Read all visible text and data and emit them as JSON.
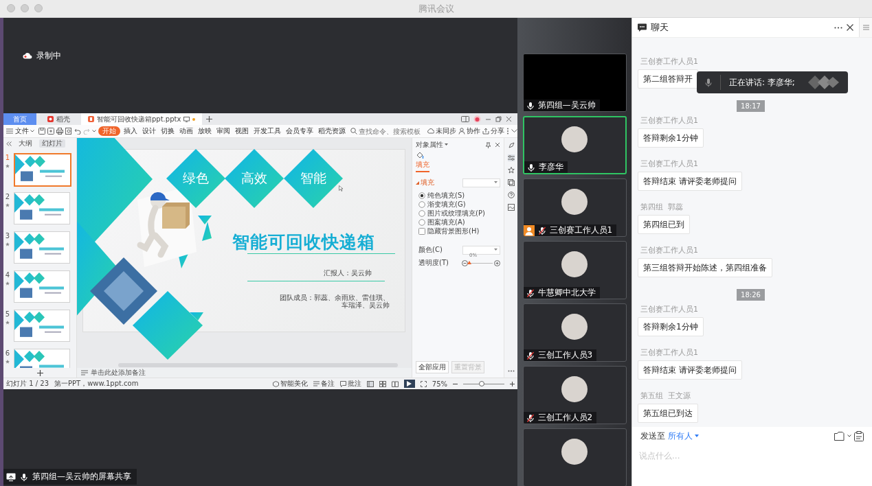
{
  "window": {
    "title": "腾讯会议"
  },
  "recording": {
    "label": "录制中"
  },
  "shared_window": {
    "tabs": [
      {
        "kind": "home",
        "label": "首页",
        "selected": false
      },
      {
        "kind": "store",
        "label": "稻壳",
        "selected": false
      },
      {
        "kind": "document",
        "label": "智能可回收快递箱ppt.pptx",
        "selected": true,
        "unsaved": true
      }
    ],
    "file_menu": "文件",
    "ribbon_tabs": [
      {
        "label": "开始",
        "selected": true
      },
      {
        "label": "插入",
        "selected": false
      },
      {
        "label": "设计",
        "selected": false
      },
      {
        "label": "切换",
        "selected": false
      },
      {
        "label": "动画",
        "selected": false
      },
      {
        "label": "放映",
        "selected": false
      },
      {
        "label": "审阅",
        "selected": false
      },
      {
        "label": "视图",
        "selected": false
      },
      {
        "label": "开发工具",
        "selected": false
      },
      {
        "label": "会员专享",
        "selected": false
      },
      {
        "label": "稻壳资源",
        "selected": false
      }
    ],
    "search": {
      "placeholder": "查找命令、搜索模板"
    },
    "actions": [
      {
        "kind": "sync",
        "label": "未同步"
      },
      {
        "kind": "collab",
        "label": "协作"
      },
      {
        "kind": "share",
        "label": "分享"
      }
    ],
    "pane_tabs": [
      {
        "label": "大纲",
        "selected": false
      },
      {
        "label": "幻灯片",
        "selected": true
      }
    ],
    "thumbnails": [
      {
        "number": "1",
        "selected": true
      },
      {
        "number": "2",
        "selected": false
      },
      {
        "number": "3",
        "selected": false
      },
      {
        "number": "4",
        "selected": false
      },
      {
        "number": "5",
        "selected": false
      },
      {
        "number": "6",
        "selected": false
      }
    ],
    "slide": {
      "tags": [
        "绿色",
        "高效",
        "智能"
      ],
      "title": "智能可回收快递箱",
      "reporter": "汇报人：吴云帅",
      "team": [
        "团队成员：郭蕊、余雨欣、雷佳琪、",
        "车瑞泽、吴云帅"
      ]
    },
    "notes": {
      "placeholder": "单击此处添加备注"
    },
    "properties": {
      "title": "对象属性",
      "tab": "填充",
      "section": "填充",
      "options": [
        {
          "kind": "radio",
          "label": "纯色填充(S)",
          "checked": true
        },
        {
          "kind": "radio",
          "label": "渐变填充(G)",
          "checked": false
        },
        {
          "kind": "radio",
          "label": "图片或纹理填充(P)",
          "checked": false
        },
        {
          "kind": "radio",
          "label": "图案填充(A)",
          "checked": false
        },
        {
          "kind": "checkbox",
          "label": "隐藏背景图形(H)",
          "checked": false
        }
      ],
      "color_label": "颜色(C)",
      "transparency_label": "透明度(T)",
      "transparency_reading": "0%",
      "transparency": {
        "level": 0
      },
      "buttons": [
        {
          "label": "全部应用",
          "disabled": false
        },
        {
          "label": "重置背景",
          "disabled": true
        }
      ]
    },
    "status_bar": {
      "slide_count": "幻灯片 1 / 23",
      "theme": "第一PPT，www.1ppt.com",
      "beautify": "智能美化",
      "notes": "备注",
      "comments": "批注",
      "views": [
        {
          "kind": "normal",
          "selected": true
        },
        {
          "kind": "sorter",
          "selected": false
        },
        {
          "kind": "reading",
          "selected": false
        }
      ],
      "zoom": "75%",
      "zoom_slider": {
        "level": 0.45
      }
    }
  },
  "screen_share": {
    "label": "第四组—吴云帅的屏幕共享"
  },
  "participants": [
    {
      "kind": "video",
      "name": "第四组—吴云帅",
      "muted": false,
      "speaking": false,
      "host": false
    },
    {
      "kind": "avatar",
      "name": "李彦华",
      "muted": false,
      "speaking": true,
      "host": false
    },
    {
      "kind": "avatar",
      "name": "三创赛工作人员1",
      "muted": true,
      "speaking": false,
      "host": true
    },
    {
      "kind": "avatar",
      "name": "牛慧卿中北大学",
      "muted": true,
      "speaking": false,
      "host": false
    },
    {
      "kind": "avatar",
      "name": "三创工作人员3",
      "muted": true,
      "speaking": false,
      "host": false
    },
    {
      "kind": "avatar",
      "name": "三创工作人员2",
      "muted": true,
      "speaking": false,
      "host": false
    },
    {
      "kind": "avatar",
      "speaking": false
    }
  ],
  "chat": {
    "title": "聊天",
    "speaking_toast": "正在讲话: 李彦华;",
    "messages": [
      {
        "kind": "message",
        "sender": "三创赛工作人员1",
        "text": "第二组答辩开"
      },
      {
        "kind": "time",
        "text": "18:17"
      },
      {
        "kind": "message",
        "sender": "三创赛工作人员1",
        "text": "答辩剩余1分钟"
      },
      {
        "kind": "message",
        "sender": "三创赛工作人员1",
        "text": "答辩结束 请评委老师提问"
      },
      {
        "kind": "message",
        "sender": "第四组  郭蕊",
        "text": "第四组已到"
      },
      {
        "kind": "message",
        "sender": "三创赛工作人员1",
        "text": "第三组答辩开始陈述，第四组准备"
      },
      {
        "kind": "time",
        "text": "18:26"
      },
      {
        "kind": "message",
        "sender": "三创赛工作人员1",
        "text": "答辩剩余1分钟"
      },
      {
        "kind": "message",
        "sender": "三创赛工作人员1",
        "text": "答辩结束 请评委老师提问"
      },
      {
        "kind": "message",
        "sender": "第五组  王文源",
        "text": "第五组已到达"
      }
    ],
    "send_to": {
      "label": "发送至",
      "target": "所有人"
    },
    "input": {
      "placeholder": "说点什么..."
    }
  }
}
